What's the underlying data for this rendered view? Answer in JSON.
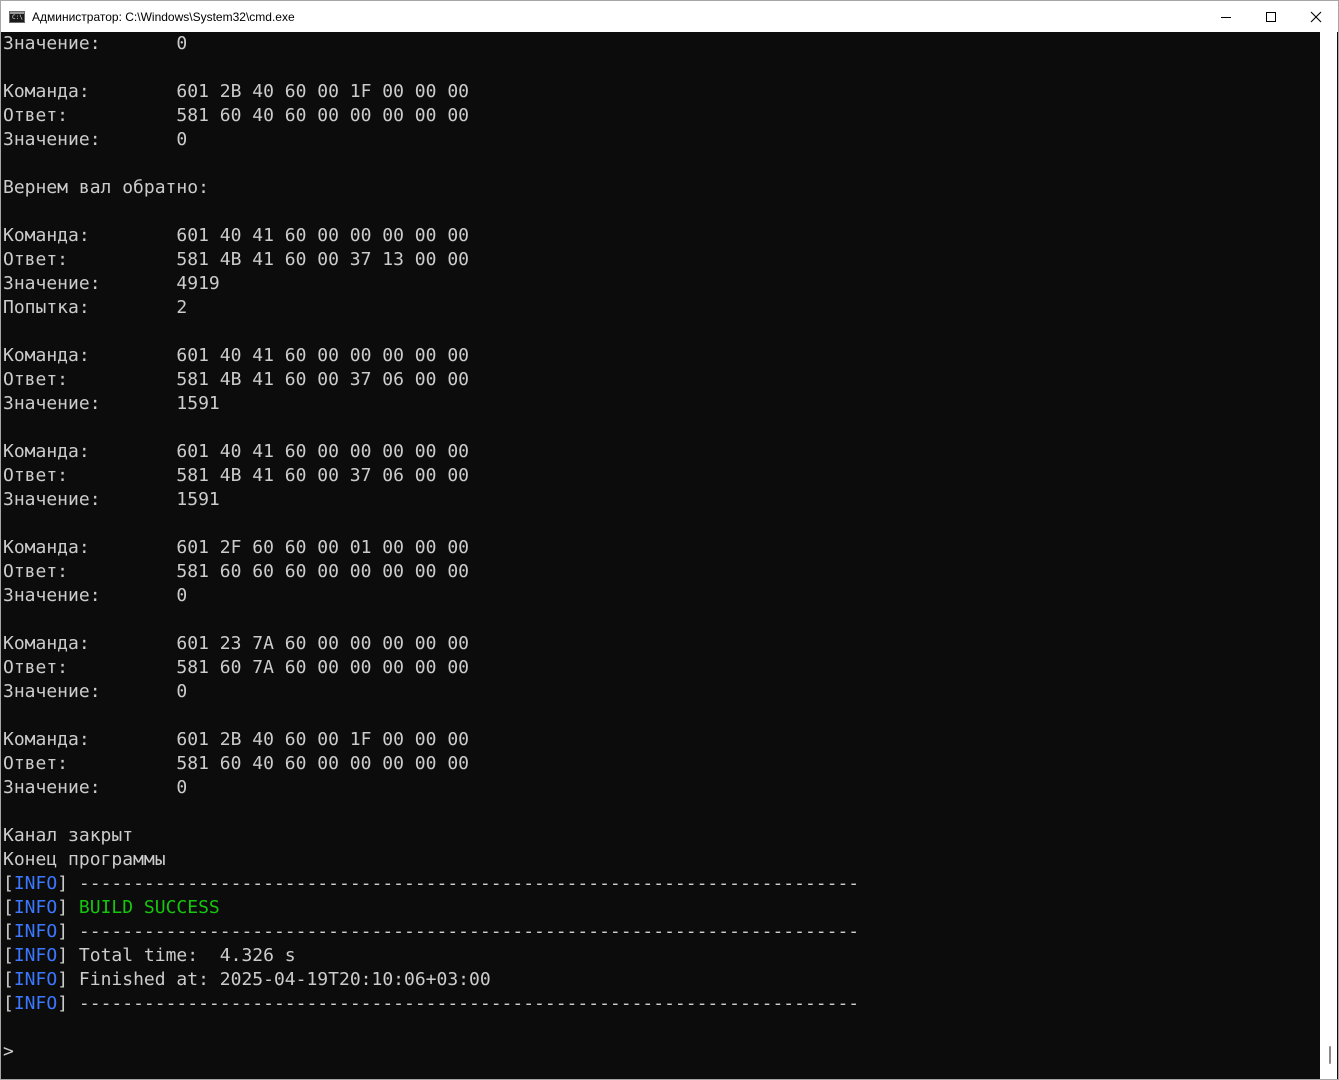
{
  "window": {
    "title": "Администратор: C:\\Windows\\System32\\cmd.exe",
    "icon_label": "C:\\",
    "controls": {
      "minimize_icon": "minimize-icon",
      "maximize_icon": "maximize-icon",
      "close_icon": "close-icon"
    }
  },
  "colors": {
    "console_bg": "#0c0c0c",
    "console_fg": "#cccccc",
    "info_blue": "#3b78ff",
    "success_green": "#16c60c"
  },
  "console": {
    "blocks": [
      {
        "lines": [
          {
            "label": "Значение:",
            "value": "0"
          }
        ]
      },
      {
        "lines": [
          {
            "label": "Команда:",
            "value": "601 2B 40 60 00 1F 00 00 00"
          },
          {
            "label": "Ответ:",
            "value": "581 60 40 60 00 00 00 00 00"
          },
          {
            "label": "Значение:",
            "value": "0"
          }
        ]
      },
      {
        "text": "Вернем вал обратно:"
      },
      {
        "lines": [
          {
            "label": "Команда:",
            "value": "601 40 41 60 00 00 00 00 00"
          },
          {
            "label": "Ответ:",
            "value": "581 4B 41 60 00 37 13 00 00"
          },
          {
            "label": "Значение:",
            "value": "4919"
          },
          {
            "label": "Попытка:",
            "value": "2"
          }
        ]
      },
      {
        "lines": [
          {
            "label": "Команда:",
            "value": "601 40 41 60 00 00 00 00 00"
          },
          {
            "label": "Ответ:",
            "value": "581 4B 41 60 00 37 06 00 00"
          },
          {
            "label": "Значение:",
            "value": "1591"
          }
        ]
      },
      {
        "lines": [
          {
            "label": "Команда:",
            "value": "601 40 41 60 00 00 00 00 00"
          },
          {
            "label": "Ответ:",
            "value": "581 4B 41 60 00 37 06 00 00"
          },
          {
            "label": "Значение:",
            "value": "1591"
          }
        ]
      },
      {
        "lines": [
          {
            "label": "Команда:",
            "value": "601 2F 60 60 00 01 00 00 00"
          },
          {
            "label": "Ответ:",
            "value": "581 60 60 60 00 00 00 00 00"
          },
          {
            "label": "Значение:",
            "value": "0"
          }
        ]
      },
      {
        "lines": [
          {
            "label": "Команда:",
            "value": "601 23 7A 60 00 00 00 00 00"
          },
          {
            "label": "Ответ:",
            "value": "581 60 7A 60 00 00 00 00 00"
          },
          {
            "label": "Значение:",
            "value": "0"
          }
        ]
      },
      {
        "lines": [
          {
            "label": "Команда:",
            "value": "601 2B 40 60 00 1F 00 00 00"
          },
          {
            "label": "Ответ:",
            "value": "581 60 40 60 00 00 00 00 00"
          },
          {
            "label": "Значение:",
            "value": "0"
          }
        ]
      }
    ],
    "closing": [
      "Канал закрыт",
      "Конец программы"
    ],
    "maven_log": [
      {
        "tag": "INFO",
        "text": "------------------------------------------------------------------------",
        "style": "plain"
      },
      {
        "tag": "INFO",
        "text": "BUILD SUCCESS",
        "style": "success"
      },
      {
        "tag": "INFO",
        "text": "------------------------------------------------------------------------",
        "style": "plain"
      },
      {
        "tag": "INFO",
        "text": "Total time:  4.326 s",
        "style": "plain"
      },
      {
        "tag": "INFO",
        "text": "Finished at: 2025-04-19T20:10:06+03:00",
        "style": "plain"
      },
      {
        "tag": "INFO",
        "text": "------------------------------------------------------------------------",
        "style": "plain"
      }
    ],
    "prompt": ">"
  }
}
